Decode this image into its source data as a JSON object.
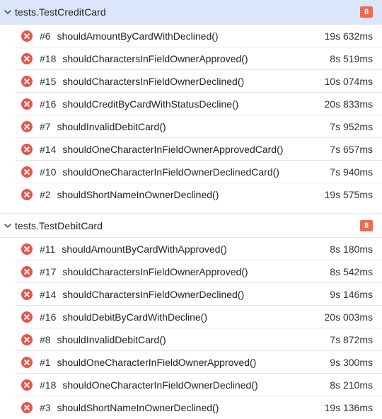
{
  "colors": {
    "selected_header_bg": "#dbe6fa",
    "fail_red": "#e4574b",
    "badge_orange": "#ee6a4c"
  },
  "suites": [
    {
      "title": "tests.TestCreditCard",
      "failed_count": "8",
      "expanded": true,
      "selected": true,
      "icon": "chevron-down-icon",
      "tests": [
        {
          "number": "#6",
          "name": "shouldAmountByCardWithDeclined()",
          "duration": "19s 632ms",
          "status_icon": "fail-icon"
        },
        {
          "number": "#18",
          "name": "shouldCharactersInFieldOwnerApproved()",
          "duration": "8s 519ms",
          "status_icon": "fail-icon"
        },
        {
          "number": "#15",
          "name": "shouldCharactersInFieldOwnerDeclined()",
          "duration": "10s 074ms",
          "status_icon": "fail-icon"
        },
        {
          "number": "#16",
          "name": "shouldCreditByCardWithStatusDecline()",
          "duration": "20s 833ms",
          "status_icon": "fail-icon"
        },
        {
          "number": "#7",
          "name": "shouldInvalidDebitCard()",
          "duration": "7s 952ms",
          "status_icon": "fail-icon"
        },
        {
          "number": "#14",
          "name": "shouldOneCharacterInFieldOwnerApprovedCard()",
          "duration": "7s 657ms",
          "status_icon": "fail-icon"
        },
        {
          "number": "#10",
          "name": "shouldOneCharacterInFieldOwnerDeclinedCard()",
          "duration": "7s 940ms",
          "status_icon": "fail-icon"
        },
        {
          "number": "#2",
          "name": "shouldShortNameInOwnerDeclined()",
          "duration": "19s 575ms",
          "status_icon": "fail-icon"
        }
      ]
    },
    {
      "title": "tests.TestDebitCard",
      "failed_count": "8",
      "expanded": true,
      "selected": false,
      "icon": "chevron-down-icon",
      "tests": [
        {
          "number": "#11",
          "name": "shouldAmountByCardWithApproved()",
          "duration": "8s 180ms",
          "status_icon": "fail-icon"
        },
        {
          "number": "#17",
          "name": "shouldCharactersInFieldOwnerApproved()",
          "duration": "8s 542ms",
          "status_icon": "fail-icon"
        },
        {
          "number": "#14",
          "name": "shouldCharactersInFieldOwnerDeclined()",
          "duration": "9s 146ms",
          "status_icon": "fail-icon"
        },
        {
          "number": "#16",
          "name": "shouldDebitByCardWithDecline()",
          "duration": "20s 003ms",
          "status_icon": "fail-icon"
        },
        {
          "number": "#8",
          "name": "shouldInvalidDebitCard()",
          "duration": "7s 872ms",
          "status_icon": "fail-icon"
        },
        {
          "number": "#1",
          "name": "shouldOneCharacterInFieldOwnerApproved()",
          "duration": "9s 300ms",
          "status_icon": "fail-icon"
        },
        {
          "number": "#18",
          "name": "shouldOneCharacterInFieldOwnerDeclined()",
          "duration": "8s 210ms",
          "status_icon": "fail-icon"
        },
        {
          "number": "#3",
          "name": "shouldShortNameInOwnerDeclined()",
          "duration": "19s 136ms",
          "status_icon": "fail-icon"
        }
      ]
    }
  ]
}
